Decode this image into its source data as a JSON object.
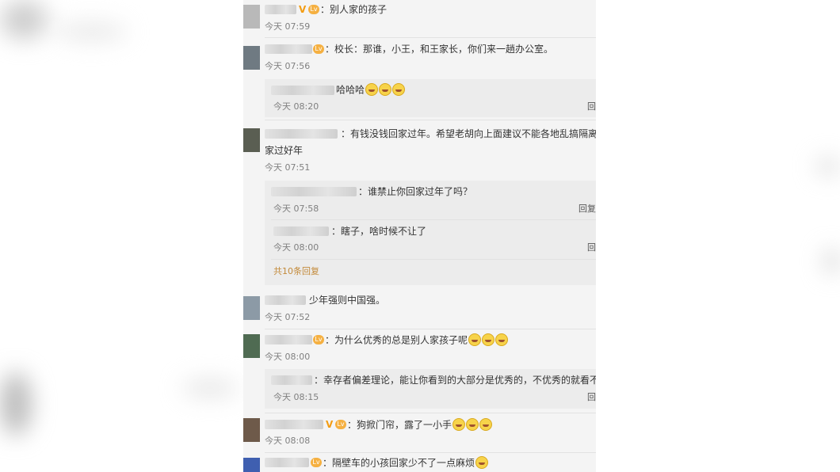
{
  "comments": [
    {
      "text": "：别人家的孩子",
      "time": "今天 07:59"
    },
    {
      "text": "：校长：那谁，小王，和王家长，你们来一趟办公室。",
      "time": "今天 07:56",
      "replies": [
        {
          "text": "哈哈哈",
          "time": "今天 08:20",
          "reply_label": "回"
        }
      ]
    },
    {
      "text_line1": "：有钱没钱回家过年。希望老胡向上面建议不能各地乱搞隔离政策",
      "text_line2": "家过好年",
      "time": "今天 07:51",
      "replies": [
        {
          "text": "：谁禁止你回家过年了吗？",
          "time": "今天 07:58",
          "reply_label": "回复"
        },
        {
          "text": "：瞎子，啥时候不让了",
          "time": "今天 08:00",
          "reply_label": "回"
        }
      ],
      "more_replies": "共10条回复"
    },
    {
      "text": "少年强则中国强。",
      "time": "今天 07:52"
    },
    {
      "text": "：为什么优秀的总是别人家孩子呢",
      "time": "今天 08:00",
      "replies": [
        {
          "text": "：幸存者偏差理论，能让你看到的大部分是优秀的，不优秀的就看不到了",
          "time": "今天 08:15",
          "reply_label": "回"
        }
      ]
    },
    {
      "text": "：狗掀门帘，露了一小手",
      "time": "今天 08:08"
    },
    {
      "text": "：隔壁车的小孩回家少不了一点麻烦"
    }
  ],
  "badges": {
    "verified": "V",
    "level": "Lv"
  },
  "icons": [
    "laugh-emoji-icon",
    "verified-badge-icon",
    "level-badge-icon",
    "fox-emoji-icon"
  ],
  "colors": {
    "panel_bg": "#f4f4f4",
    "reply_bg": "#ececec",
    "more_link": "#c38a3a",
    "time": "#808080"
  }
}
